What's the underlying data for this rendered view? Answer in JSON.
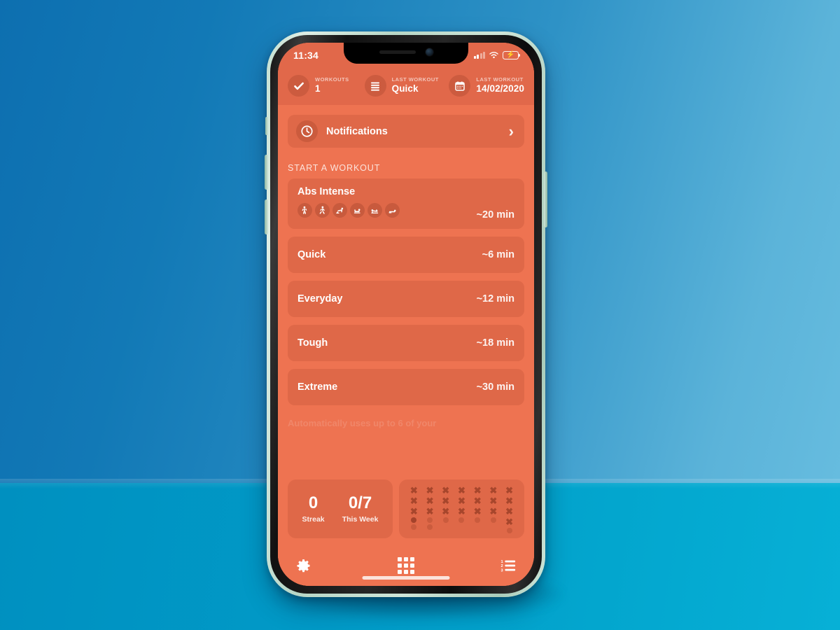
{
  "status_bar": {
    "time": "11:34",
    "signal_icon": "cellular-signal-icon",
    "wifi_icon": "wifi-icon",
    "battery_icon": "battery-charging-icon"
  },
  "header": {
    "stats": [
      {
        "icon": "check-circle-icon",
        "label": "WORKOUTS",
        "value": "1"
      },
      {
        "icon": "list-lines-icon",
        "label": "LAST WORKOUT",
        "value": "Quick"
      },
      {
        "icon": "calendar-icon",
        "label": "LAST WORKOUT",
        "value": "14/02/2020"
      }
    ]
  },
  "notifications": {
    "icon": "clock-icon",
    "label": "Notifications",
    "chevron": "›"
  },
  "section": {
    "title": "START A WORKOUT"
  },
  "featured_workout": {
    "name": "Abs Intense",
    "duration": "~20 min",
    "exercise_icons": [
      "exercise-standing-icon",
      "exercise-lunge-icon",
      "exercise-pushup-icon",
      "exercise-situp-icon",
      "exercise-plank-icon",
      "exercise-lying-icon"
    ]
  },
  "workouts": [
    {
      "name": "Quick",
      "duration": "~6 min"
    },
    {
      "name": "Everyday",
      "duration": "~12 min"
    },
    {
      "name": "Tough",
      "duration": "~18 min"
    },
    {
      "name": "Extreme",
      "duration": "~30 min"
    }
  ],
  "ghost_text": "Automatically uses up to 6 of your",
  "stats_panel": {
    "streak": {
      "value": "0",
      "caption": "Streak"
    },
    "this_week": {
      "value": "0/7",
      "caption": "This Week"
    },
    "history": {
      "columns": [
        {
          "marks": 3,
          "dots": [
            1,
            0
          ]
        },
        {
          "marks": 3,
          "dots": [
            0,
            0
          ]
        },
        {
          "marks": 3,
          "dots": [
            0
          ]
        },
        {
          "marks": 3,
          "dots": [
            0
          ]
        },
        {
          "marks": 3,
          "dots": [
            0
          ]
        },
        {
          "marks": 3,
          "dots": [
            0
          ]
        },
        {
          "marks": 4,
          "dots": [
            0
          ]
        }
      ],
      "mark_glyph": "✖"
    }
  },
  "tabbar": {
    "items": [
      {
        "icon": "gear-icon",
        "name": "settings"
      },
      {
        "icon": "grid-icon",
        "name": "workouts"
      },
      {
        "icon": "numbered-list-icon",
        "name": "exercises"
      }
    ]
  },
  "colors": {
    "app_background": "#ee7351",
    "header_background": "#e1684a",
    "card_overlay": "rgba(150,55,30,0.17)",
    "battery_green": "#35c759",
    "phone_frame": "#cfe5d8",
    "sky_top": "#0d6fb0",
    "ground": "#019ac7"
  }
}
